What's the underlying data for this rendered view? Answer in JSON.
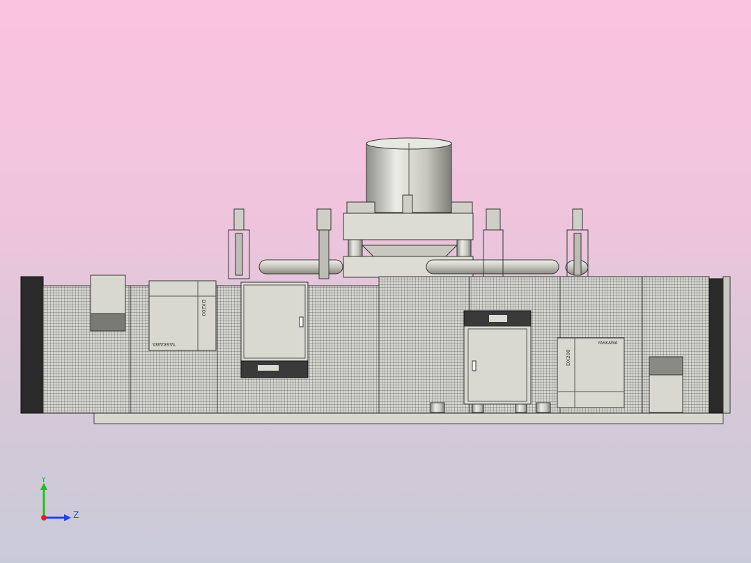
{
  "viewport": {
    "background_top": "#fbc3e0",
    "background_bottom": "#c9cad8",
    "model_line_color": "#3a3a3a",
    "model_fill_color": "#d9d9d2",
    "metal_color": "#bdbdb5"
  },
  "cabinets": {
    "left_controller_label": "DX200",
    "left_controller_brand": "YASKAWA",
    "right_controller_label": "DX200",
    "right_controller_brand": "YASKAWA"
  },
  "triad": {
    "y_label": "Y",
    "z_label": "Z",
    "y_color": "#1fbf1f",
    "z_color": "#1f3fff",
    "x_color": "#e02020"
  }
}
